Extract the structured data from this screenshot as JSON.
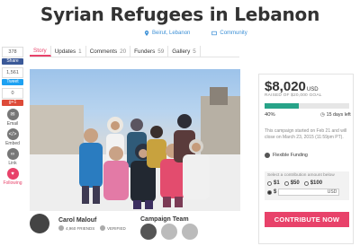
{
  "page": {
    "title": "Syrian Refugees in Lebanon"
  },
  "meta": {
    "location": "Beirut, Lebanon",
    "category": "Community"
  },
  "social": {
    "share_count": "378",
    "facebook_label": "Share",
    "like_count": "1,561",
    "tweet_label": "Tweet",
    "gplus_count": "0",
    "gplus_label": "g+1",
    "email_label": "Email",
    "embed_label": "Embed",
    "link_label": "Link",
    "following_label": "Following"
  },
  "tabs": [
    {
      "label": "Story",
      "count": ""
    },
    {
      "label": "Updates",
      "count": "1"
    },
    {
      "label": "Comments",
      "count": "20"
    },
    {
      "label": "Funders",
      "count": "59"
    },
    {
      "label": "Gallery",
      "count": "5"
    }
  ],
  "creator": {
    "name": "Carol Malouf",
    "friends": "4,960 FRIENDS",
    "verified": "VERIFIED"
  },
  "team": {
    "title": "Campaign Team"
  },
  "funding": {
    "amount": "$8,020",
    "currency": "USD",
    "raised_text": "RAISED OF $20,000 GOAL",
    "percent_label": "40%",
    "percent_value": 40,
    "days_left": "15 days left",
    "campaign_text": "This campaign started on Feb 21 and will close on March 23, 2015 (11:59pm PT).",
    "flexible": "Flexible Funding",
    "select_label": "Select a contribution amount below",
    "options": [
      "$1",
      "$50",
      "$100"
    ],
    "custom_prefix": "$",
    "custom_currency": "USD",
    "contribute_label": "CONTRIBUTE NOW"
  },
  "colors": {
    "accent": "#e8426a",
    "progress": "#27a388",
    "link": "#3b8fd6"
  }
}
